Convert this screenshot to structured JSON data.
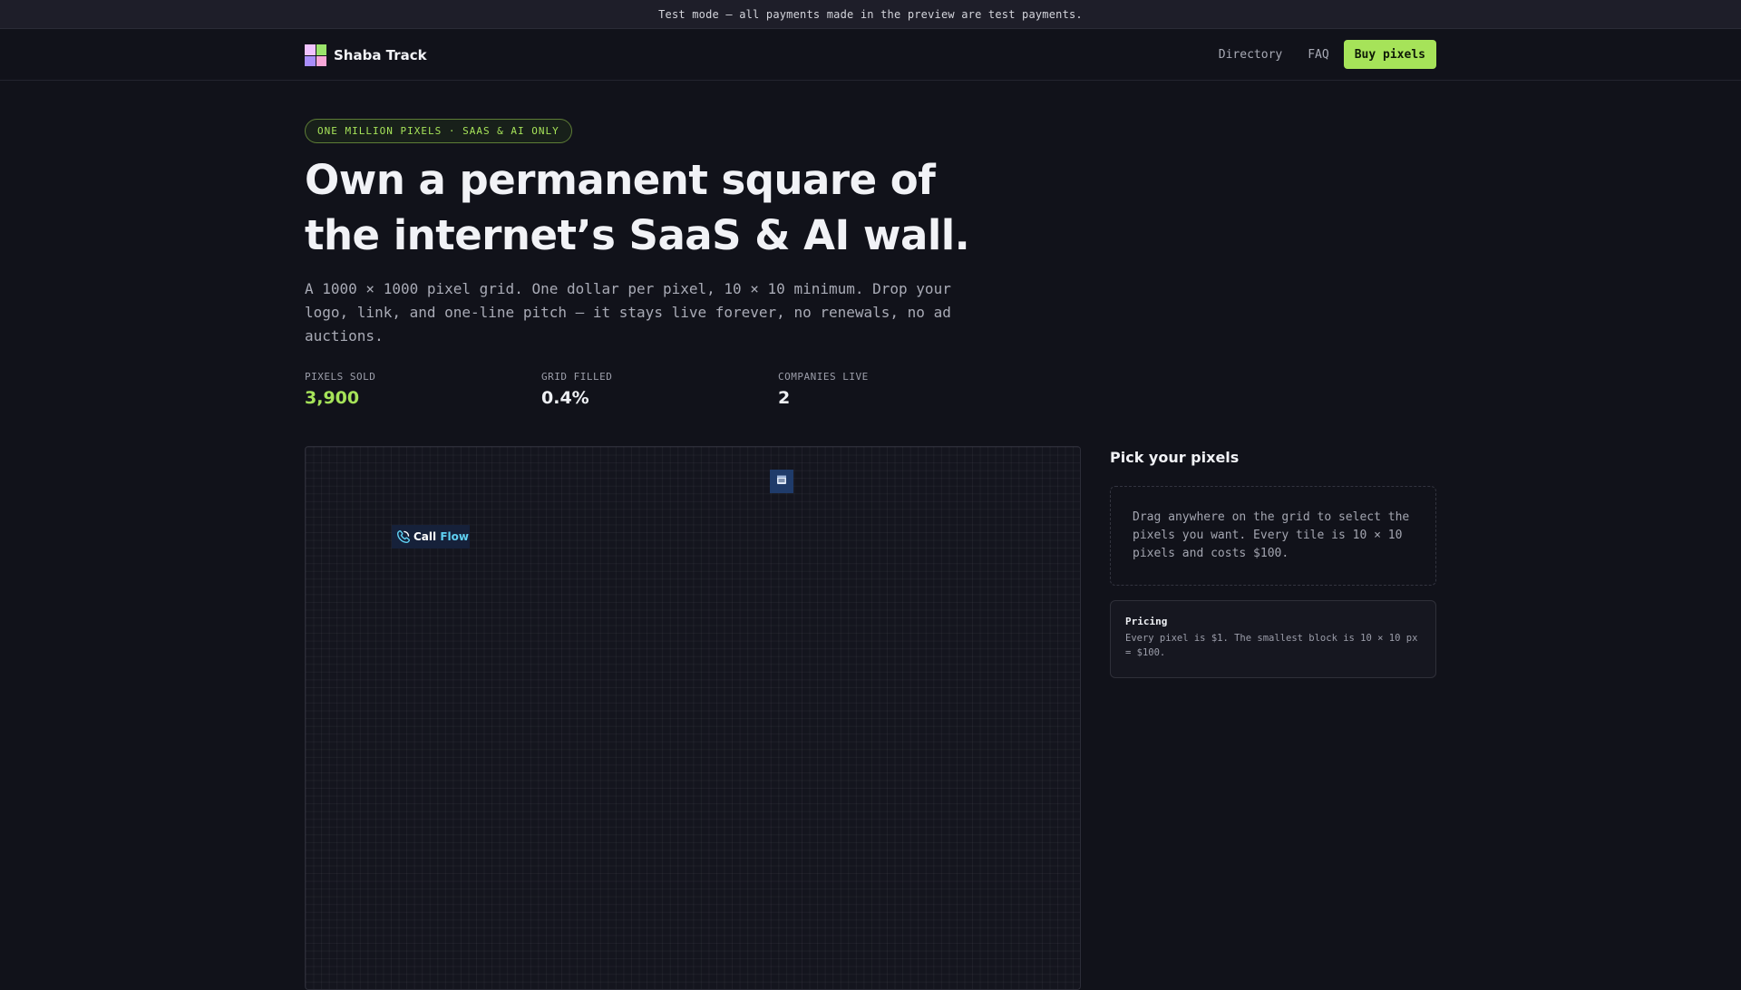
{
  "banner": {
    "text": "Test mode — all payments made in the preview are test payments."
  },
  "nav": {
    "brand_name": "Shaba Track",
    "links": [
      "Directory",
      "FAQ"
    ],
    "buy_label": "Buy pixels"
  },
  "hero": {
    "badge": "ONE MILLION PIXELS · SAAS & AI ONLY",
    "title": "Own a permanent square of the internet’s SaaS & AI wall.",
    "description": "A 1000 × 1000 pixel grid. One dollar per pixel, 10 × 10 minimum. Drop your logo, link, and one-line pitch — it stays live forever, no renewals, no ad auctions."
  },
  "stats": [
    {
      "label": "PIXELS SOLD",
      "value": "3,900"
    },
    {
      "label": "GRID FILLED",
      "value": "0.4%"
    },
    {
      "label": "COMPANIES LIVE",
      "value": "2"
    }
  ],
  "grid": {
    "tiles": [
      {
        "name": "Call Flow",
        "name_part1": "Call",
        "name_part2": "Flow",
        "icon": "phone-icon"
      },
      {
        "name": "calendar tile",
        "icon": "calendar-icon"
      }
    ]
  },
  "side": {
    "title": "Pick your pixels",
    "hint": "Drag anywhere on the grid to select the pixels you want. Every tile is 10 × 10 pixels and costs $100.",
    "pricing_title": "Pricing",
    "pricing_text": "Every pixel is $1. The smallest block is 10 × 10 px = $100."
  },
  "colors": {
    "accent": "#a6e359",
    "background": "#11121a"
  }
}
